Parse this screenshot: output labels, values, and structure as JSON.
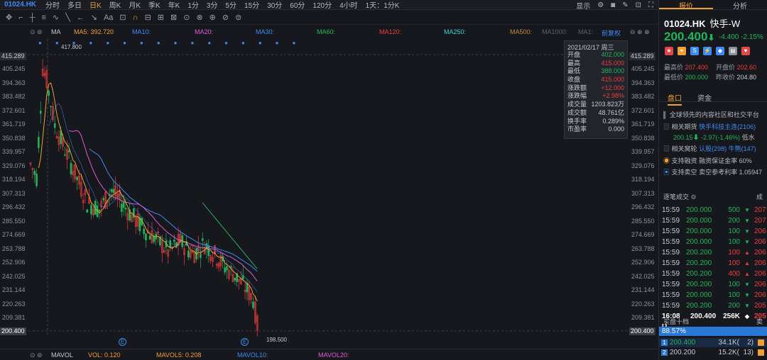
{
  "toolbar": {
    "symbol": "01024.HK",
    "periods": [
      "分时",
      "多日",
      "日K",
      "周K",
      "月K",
      "季K",
      "年K",
      "1分",
      "3分",
      "5分",
      "15分",
      "30分",
      "60分",
      "120分",
      "4小时",
      "1天：1分K"
    ],
    "active_period": "日K",
    "display_label": "显示"
  },
  "tools": [
    "✥",
    "⌐",
    "┼",
    "≡",
    "∿",
    "╲",
    "←",
    "↘",
    "Aa",
    "⊡",
    "∩",
    "⊟",
    "⊞",
    "⊠",
    "⊙",
    "⊗",
    "⊕",
    "⊘",
    "⊜"
  ],
  "ma_bar": {
    "label": "MA",
    "ma5": "MA5: 392.720",
    "ma10": "MA10:",
    "ma20": "MA20:",
    "ma30": "MA30:",
    "ma60": "MA60:",
    "ma120": "MA120:",
    "ma250": "MA250:",
    "ma500": "MA500:",
    "ma1000": "MA1000:",
    "ma1": "MA1:",
    "adjust": "前复权",
    "colors": {
      "ma5": "#f0a030",
      "ma10": "#3d8bf5",
      "ma20": "#e05ad8",
      "ma30": "#3d8bf5",
      "ma60": "#1fb55a",
      "ma120": "#f03c3c",
      "ma250": "#2ed6d6",
      "ma500": "#c08a3a",
      "ma1000": "#5a6070",
      "ma1": "#5a6070",
      "adjust": "#3d8bf5"
    }
  },
  "axis": {
    "ticks": [
      "405.245",
      "394.363",
      "383.482",
      "372.601",
      "361.719",
      "350.838",
      "339.957",
      "329.076",
      "318.194",
      "307.313",
      "296.432",
      "285.550",
      "274.669",
      "263.788",
      "252.906",
      "242.025",
      "231.144",
      "220.263",
      "209.381"
    ],
    "high_label": "415.289",
    "last_label": "200.400",
    "high_marker": "417.800",
    "low_marker": "198.500"
  },
  "info_box": {
    "date": "2021/02/17 周三",
    "rows": [
      {
        "k": "开盘",
        "v": "402.000",
        "c": "#1fb55a"
      },
      {
        "k": "最高",
        "v": "415.000",
        "c": "#f03c3c"
      },
      {
        "k": "最低",
        "v": "388.000",
        "c": "#1fb55a"
      },
      {
        "k": "收盘",
        "v": "415.000",
        "c": "#f03c3c"
      },
      {
        "k": "涨跌额",
        "v": "+12.000",
        "c": "#f03c3c"
      },
      {
        "k": "涨跌幅",
        "v": "+2.98%",
        "c": "#f03c3c"
      },
      {
        "k": "成交量",
        "v": "1203.823万",
        "c": "#c7cbd1"
      },
      {
        "k": "成交额",
        "v": "48.761亿",
        "c": "#c7cbd1"
      },
      {
        "k": "换手率",
        "v": "0.289%",
        "c": "#c7cbd1"
      },
      {
        "k": "市盈率",
        "v": "0.000",
        "c": "#c7cbd1"
      }
    ]
  },
  "vol_bar": {
    "label": "MAVOL",
    "vol": "VOL: 0.120",
    "mavol5": "MAVOL5: 0.208",
    "mavol10": "MAVOL10:",
    "mavol20": "MAVOL20:"
  },
  "panel": {
    "tabs": [
      "报价",
      "分析"
    ],
    "code": "01024.HK",
    "name": "快手-W",
    "price": "200.400",
    "arrow": "⬇",
    "change": "-4.400",
    "change_pct": "-2.15%",
    "stats": [
      {
        "k": "最高价",
        "v": "207.400",
        "c": "#f03c3c"
      },
      {
        "k": "开盘价",
        "v": "202.60",
        "c": "#f03c3c"
      },
      {
        "k": "最低价",
        "v": "200.000",
        "c": "#1fb55a"
      },
      {
        "k": "昨收价",
        "v": "204.80",
        "c": "#c7cbd1"
      }
    ],
    "subtabs": [
      "盘口",
      "资金"
    ],
    "intro": "全球领先的内容社区和社交平台",
    "futures_label": "相关期货",
    "futures_value": "快手科技主连(2106)",
    "futures_price": "200.15⬇ -2.97(-1.46%)",
    "futures_tail": "低水",
    "warrants_label": "相关窝轮",
    "warrants_value": "认股(298)",
    "warrants_value2": "牛熊(147)",
    "margin_label": "支持融资",
    "margin_value": "融资保证金率 60%",
    "short_label": "支持卖空",
    "short_value": "卖空参考利率 1.05947",
    "trades_title": "逐笔成交",
    "trades": [
      {
        "t": "15:59",
        "p": "200.000",
        "v": "500",
        "d": "▼"
      },
      {
        "t": "15:59",
        "p": "200.000",
        "v": "200",
        "d": "▼"
      },
      {
        "t": "15:59",
        "p": "200.000",
        "v": "100",
        "d": "▼"
      },
      {
        "t": "15:59",
        "p": "200.000",
        "v": "100",
        "d": "▼"
      },
      {
        "t": "15:59",
        "p": "200.200",
        "v": "100",
        "d": "▲"
      },
      {
        "t": "15:59",
        "p": "200.200",
        "v": "100",
        "d": "▲"
      },
      {
        "t": "15:59",
        "p": "200.200",
        "v": "400",
        "d": "▲"
      },
      {
        "t": "15:59",
        "p": "200.200",
        "v": "100",
        "d": "▼"
      },
      {
        "t": "15:59",
        "p": "200.000",
        "v": "100",
        "d": "▼"
      },
      {
        "t": "15:59",
        "p": "200.200",
        "v": "200",
        "d": "▼"
      }
    ],
    "last_trade": {
      "t": "16:08 U",
      "p": "200.400",
      "v": "256K",
      "d": "◆"
    },
    "right_col": [
      "207",
      "207",
      "206",
      "206",
      "206",
      "206",
      "206",
      "206",
      "206",
      "205"
    ],
    "book_title": "买盘十档",
    "book_pct": "88.57%",
    "bids": [
      {
        "n": "1",
        "p": "200.400",
        "v": "34.1K(",
        "c": "2)"
      },
      {
        "n": "2",
        "p": "200.200",
        "v": "15.2K(",
        "c": "13)"
      }
    ]
  }
}
